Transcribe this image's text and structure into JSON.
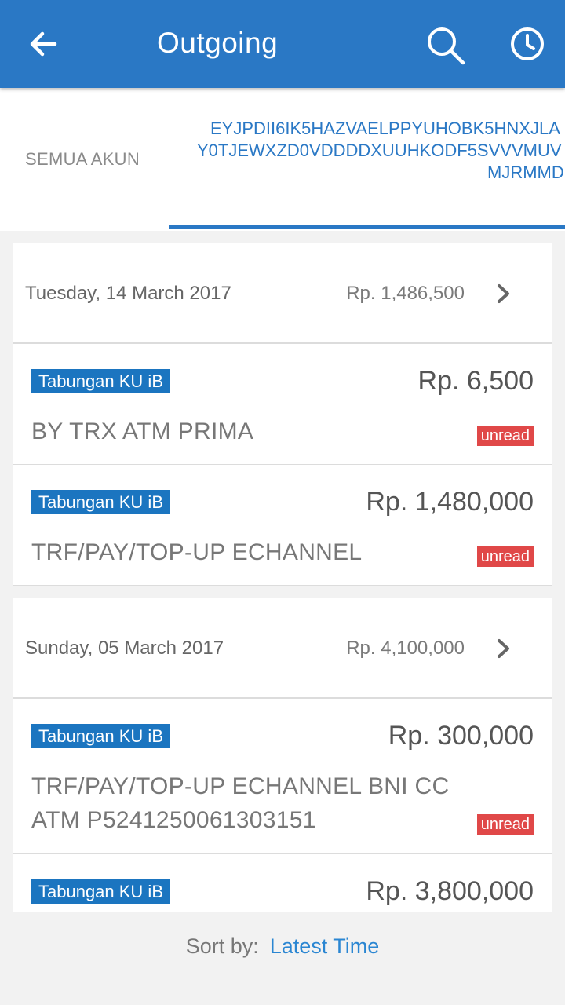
{
  "appbar": {
    "title": "Outgoing",
    "back_icon": "arrow-left-icon",
    "search_icon": "search-icon",
    "history_icon": "clock-icon"
  },
  "tabs": {
    "all_label": "SEMUA AKUN",
    "account_line1": "EYJPDII6IK5HAZVAELPPYUHOBK5HNXJLA",
    "account_line2": "Y0TJEWXZD0VDDDDXUUHKODF5SVVVMUV",
    "account_line3": "MJRMMD"
  },
  "groups": [
    {
      "date": "Tuesday, 14 March 2017",
      "total": "Rp. 1,486,500",
      "transactions": [
        {
          "account": "Tabungan KU iB",
          "amount": "Rp. 6,500",
          "description": "BY TRX ATM PRIMA",
          "status": "unread"
        },
        {
          "account": "Tabungan KU iB",
          "amount": "Rp. 1,480,000",
          "description": "TRF/PAY/TOP-UP ECHANNEL",
          "status": "unread"
        }
      ]
    },
    {
      "date": "Sunday, 05 March 2017",
      "total": "Rp. 4,100,000",
      "transactions": [
        {
          "account": "Tabungan KU iB",
          "amount": "Rp. 300,000",
          "description": "TRF/PAY/TOP-UP ECHANNEL BNI CC ATM P5241250061303151",
          "status": "unread"
        },
        {
          "account": "Tabungan KU iB",
          "amount": "Rp. 3,800,000",
          "description": "",
          "status": ""
        }
      ]
    }
  ],
  "sort": {
    "label": "Sort by:",
    "value": "Latest Time"
  },
  "colors": {
    "primary": "#2a78c5",
    "unread": "#e04848",
    "account_badge": "#1b75c0"
  }
}
